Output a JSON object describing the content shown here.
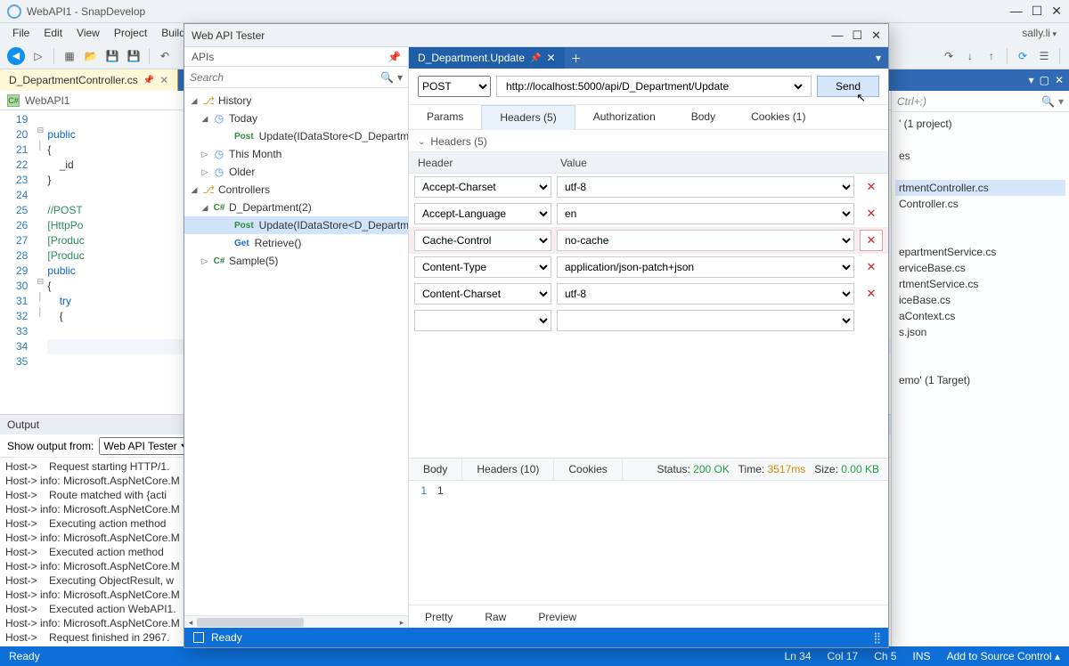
{
  "ide": {
    "title": "WebAPI1 - SnapDevelop",
    "menus": [
      "File",
      "Edit",
      "View",
      "Project",
      "Build"
    ],
    "user": "sally.li",
    "doc_tab": "D_DepartmentController.cs",
    "crumb": "WebAPI1",
    "code_start_line": 19,
    "code_lines": [
      "",
      "public",
      "{",
      "    _id",
      "}",
      "",
      "//POST",
      "[HttpPo",
      "[Produc",
      "[Produc",
      "public",
      "{",
      "    try",
      "    {",
      "",
      "",
      ""
    ],
    "highlight_line_index": 15,
    "output": {
      "title": "Output",
      "from_label": "Show output from:",
      "from_value": "Web API Tester",
      "lines": [
        "Host->    Request starting HTTP/1.",
        "Host-> info: Microsoft.AspNetCore.M",
        "Host->    Route matched with {acti",
        "Host-> info: Microsoft.AspNetCore.M",
        "Host->    Executing action method",
        "Host-> info: Microsoft.AspNetCore.M",
        "Host->    Executed action method",
        "Host-> info: Microsoft.AspNetCore.M",
        "Host->    Executing ObjectResult, w",
        "Host-> info: Microsoft.AspNetCore.M",
        "Host->    Executed action WebAPI1.",
        "Host-> info: Microsoft.AspNetCore.M",
        "Host->    Request finished in 2967."
      ]
    },
    "status": {
      "ready": "Ready",
      "ln": "Ln 34",
      "col": "Col 17",
      "ch": "Ch 5",
      "ins": "INS",
      "src": "Add to Source Control ▴"
    },
    "solution": {
      "search_ph": "Ctrl+;)",
      "items": [
        "' (1 project)",
        "",
        "es",
        "",
        "rtmentController.cs",
        "Controller.cs",
        "",
        "",
        "epartmentService.cs",
        "erviceBase.cs",
        "rtmentService.cs",
        "iceBase.cs",
        "aContext.cs",
        "s.json",
        "",
        "",
        "emo' (1 Target)"
      ],
      "sel_index": 4
    }
  },
  "tester": {
    "title": "Web API Tester",
    "apis_label": "APIs",
    "search_ph": "Search",
    "tree": {
      "history": "History",
      "today": "Today",
      "today_item": "Update(IDataStore<D_Departme",
      "this_month": "This Month",
      "older": "Older",
      "controllers": "Controllers",
      "dept": "D_Department(2)",
      "dept_update": "Update(IDataStore<D_Departme",
      "dept_retrieve": "Retrieve()",
      "sample": "Sample(5)"
    },
    "req_tab": "D_Department.Update",
    "method": "POST",
    "url": "http://localhost:5000/api/D_Department/Update",
    "send": "Send",
    "tabs": {
      "params": "Params",
      "headers": "Headers  (5)",
      "auth": "Authorization",
      "body": "Body",
      "cookies": "Cookies  (1)"
    },
    "headers_section": "Headers  (5)",
    "grid_head": {
      "header": "Header",
      "value": "Value"
    },
    "rows": [
      {
        "h": "Accept-Charset",
        "v": "utf-8"
      },
      {
        "h": "Accept-Language",
        "v": "en"
      },
      {
        "h": "Cache-Control",
        "v": "no-cache"
      },
      {
        "h": "Content-Type",
        "v": "application/json-patch+json"
      },
      {
        "h": "Content-Charset",
        "v": "utf-8"
      }
    ],
    "highlight_row": 2,
    "resp": {
      "tabs": {
        "body": "Body",
        "headers": "Headers  (10)",
        "cookies": "Cookies"
      },
      "status_label": "Status:",
      "status_val": "200 OK",
      "time_label": "Time:",
      "time_val": "3517ms",
      "size_label": "Size:",
      "size_val": "0.00 KB",
      "body_line_no": "1",
      "body_text": "1",
      "foot": {
        "pretty": "Pretty",
        "raw": "Raw",
        "preview": "Preview"
      }
    },
    "status_ready": "Ready"
  }
}
